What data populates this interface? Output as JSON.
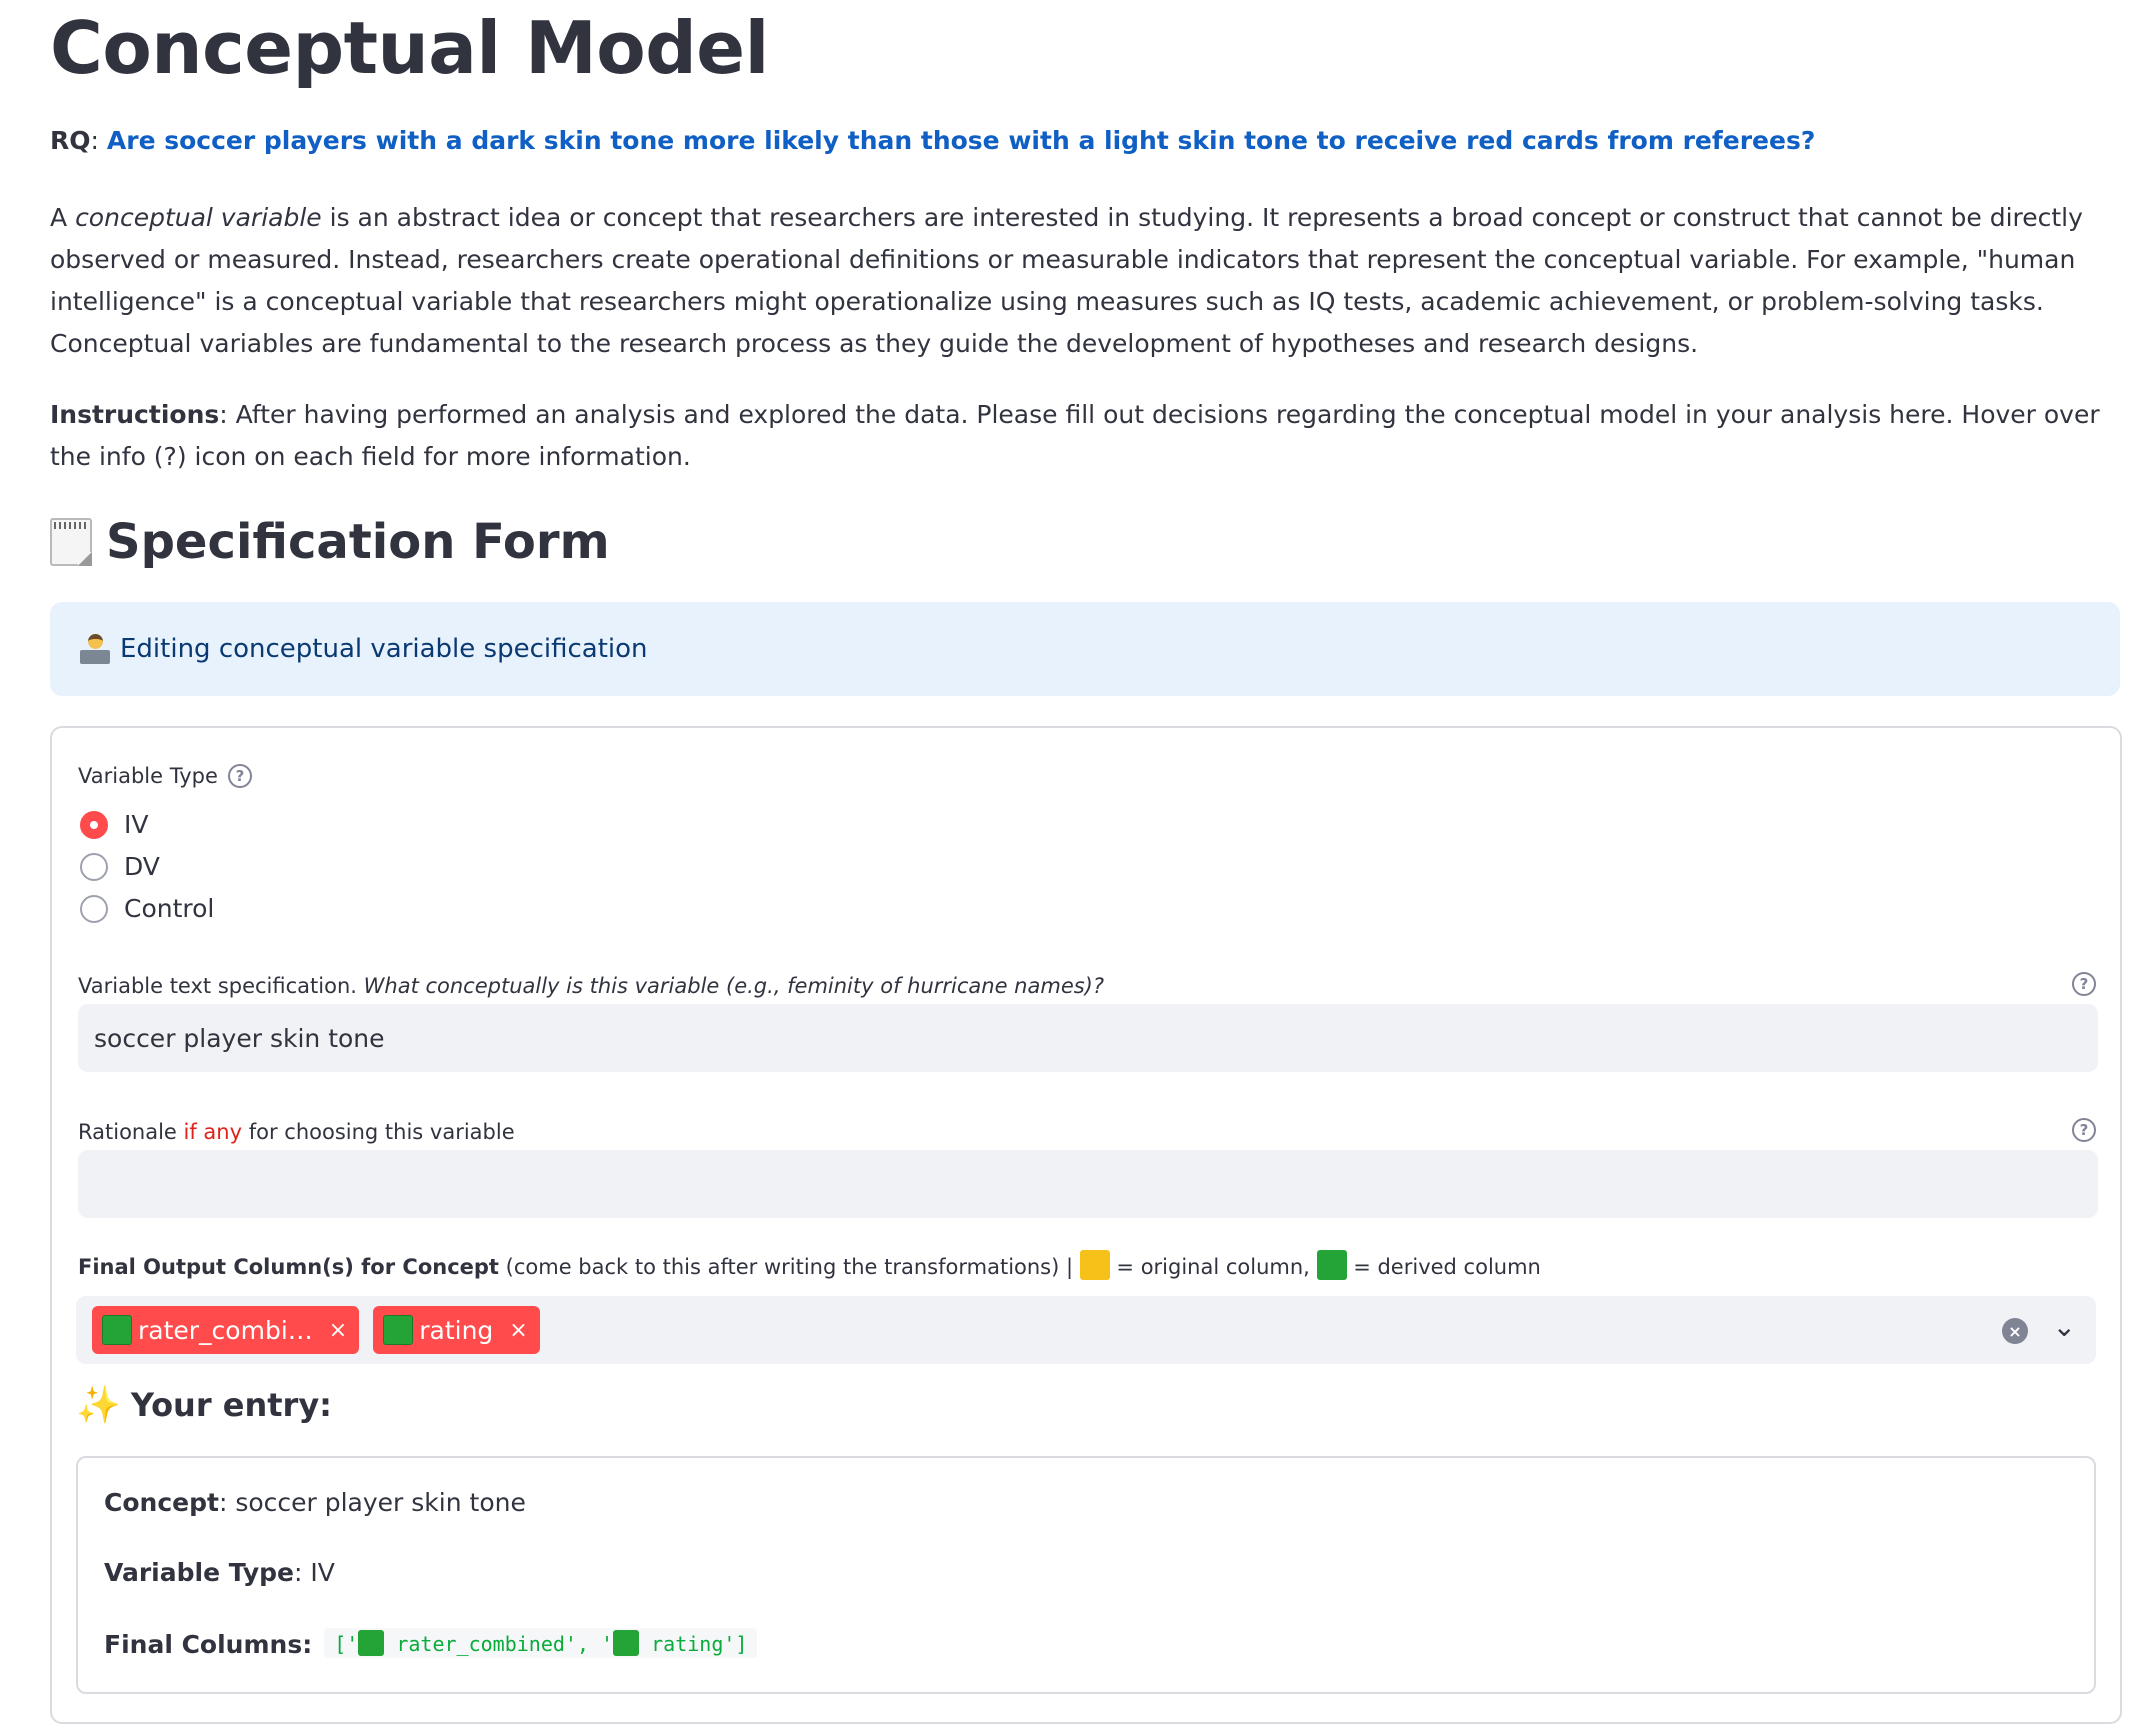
{
  "page": {
    "title": "Conceptual Model",
    "rq_label": "RQ",
    "rq_sep": ": ",
    "rq_question": "Are soccer players with a dark skin tone more likely than those with a light skin tone to receive red cards from referees?",
    "para_a": "A ",
    "para_term": "conceptual variable",
    "para_rest": " is an abstract idea or concept that researchers are interested in studying. It represents a broad concept or construct that cannot be directly observed or measured. Instead, researchers create operational definitions or measurable indicators that represent the conceptual variable. For example, \"human intelligence\" is a conceptual variable that researchers might operationalize using measures such as IQ tests, academic achievement, or problem-solving tasks. Conceptual variables are fundamental to the research process as they guide the development of hypotheses and research designs.",
    "instructions_label": "Instructions",
    "instructions_text": ": After having performed an analysis and explored the data. Please fill out decisions regarding the conceptual model in your analysis here. Hover over the info (?) icon on each field for more information.",
    "section_title": "Specification Form",
    "section_icon": "spiral-notepad-icon",
    "banner_icon": "technologist-icon",
    "banner_text": "Editing conceptual variable specification"
  },
  "form": {
    "variable_type_label": "Variable Type",
    "variable_type_options": [
      "IV",
      "DV",
      "Control"
    ],
    "variable_type_selected": "IV",
    "text_spec_label_plain": "Variable text specification. ",
    "text_spec_label_italic": "What conceptually is this variable (e.g., feminity of hurricane names)?",
    "text_spec_value": "soccer player skin tone",
    "rationale_label_pre": "Rationale ",
    "rationale_label_red": "if any",
    "rationale_label_post": " for choosing this variable",
    "rationale_value": "",
    "columns_label_bold": "Final Output Column(s) for Concept",
    "columns_label_note": " (come back to this after writing the transformations) | ",
    "columns_legend_original": " = original column, ",
    "columns_legend_derived": " = derived column",
    "selected_columns": [
      "rater_combi…",
      "rating"
    ],
    "help_glyph": "?",
    "tag_remove_glyph": "×",
    "clear_glyph": "×",
    "dropdown_glyph": "⌄"
  },
  "entry": {
    "heading": "Your entry:",
    "heading_icon": "sparkles-icon",
    "concept_label": "Concept",
    "concept_value": ": soccer player skin tone",
    "type_label": "Variable Type",
    "type_value": ": IV",
    "columns_label": "Final Columns:",
    "code_open": "['",
    "code_item1": " rater_combined', '",
    "code_item2": " rating']"
  },
  "colors": {
    "accent": "#ff4b4b",
    "link_blue": "#0f5fc4",
    "banner_bg": "#e8f2fc",
    "original_column": "#f6c21a",
    "derived_column": "#24a336"
  }
}
